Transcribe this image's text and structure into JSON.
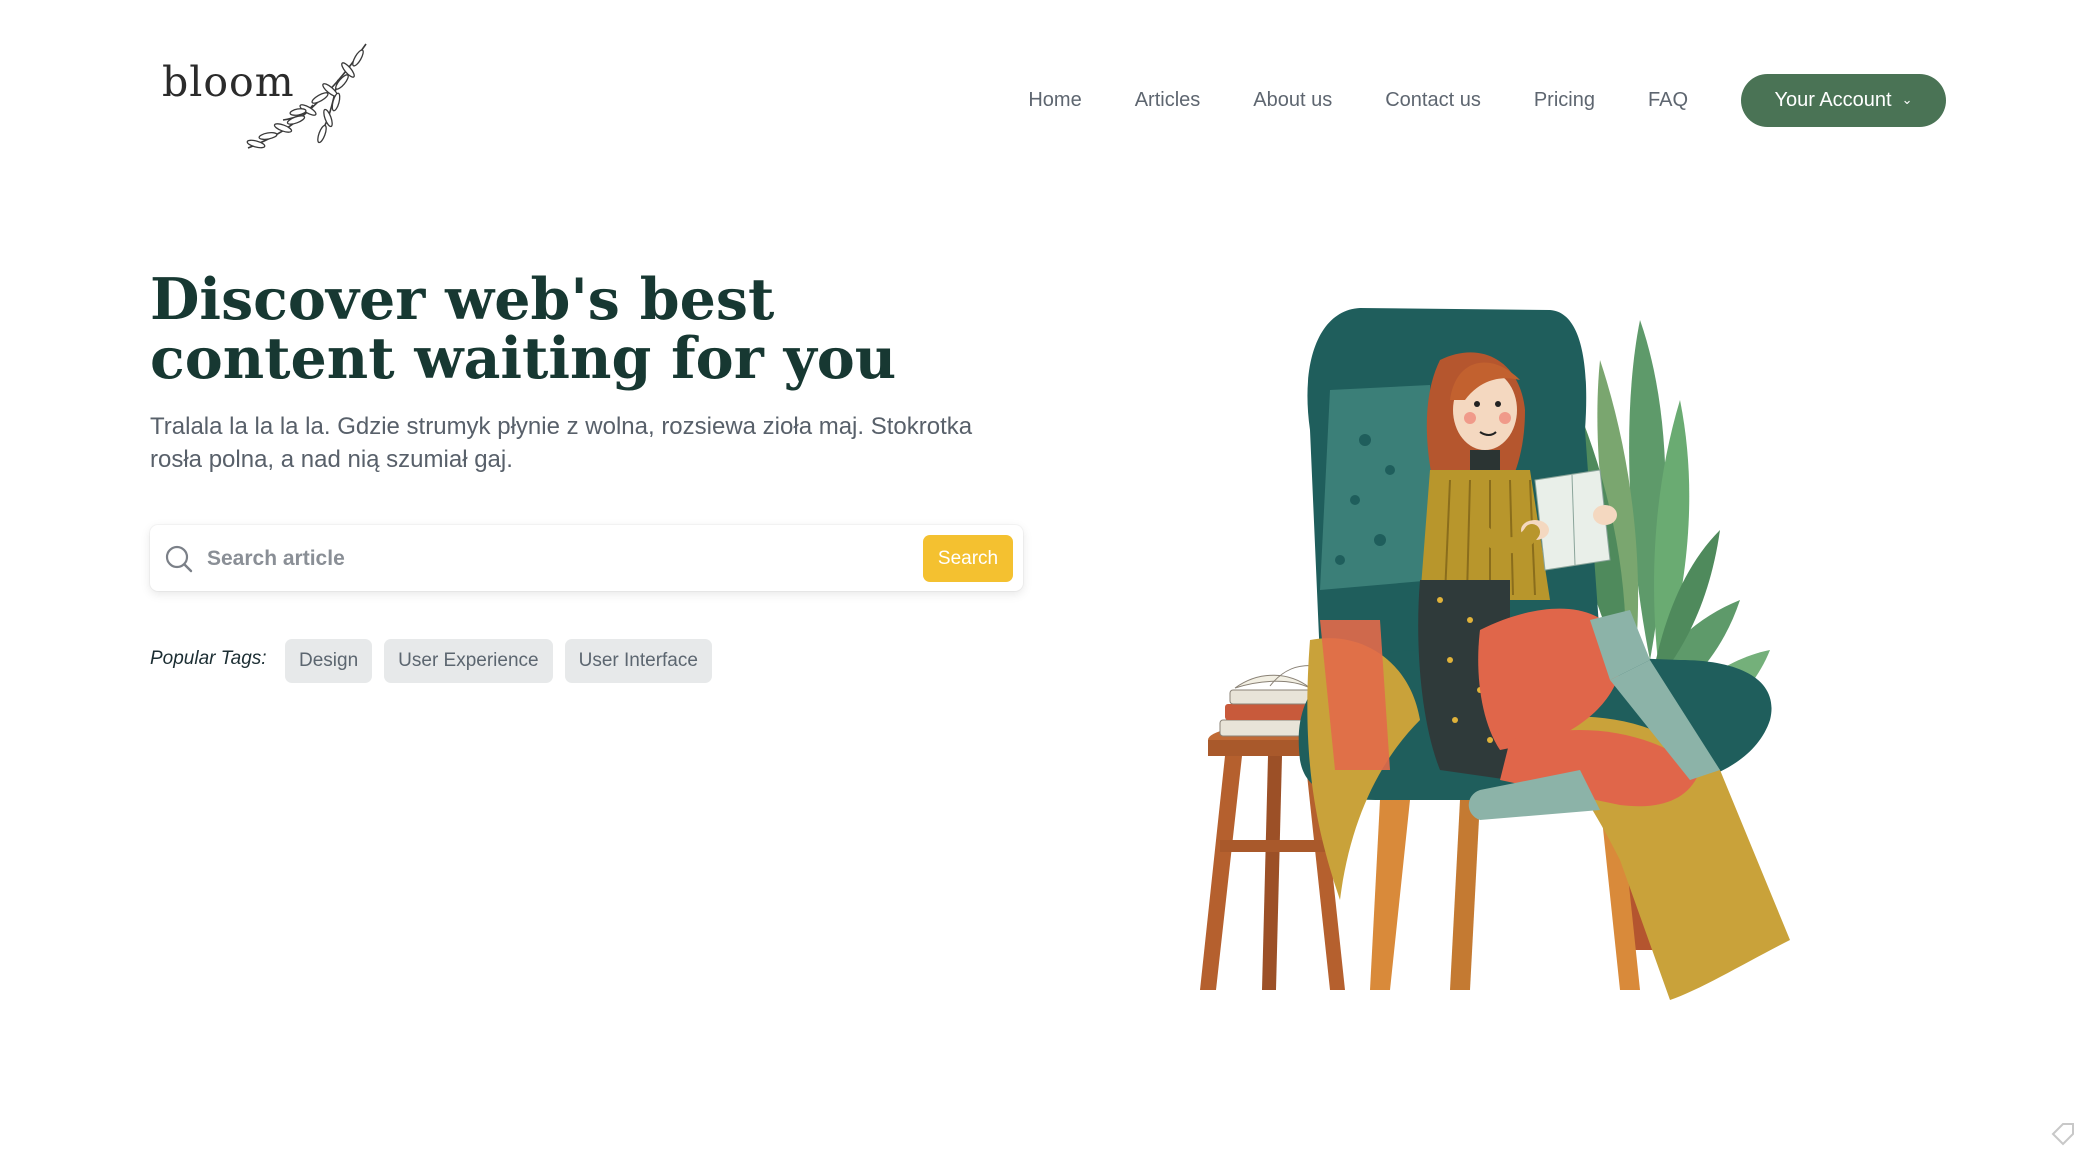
{
  "brand": {
    "name": "bloom",
    "logo_icon": "olive-branch-icon"
  },
  "nav": {
    "links": [
      "Home",
      "Articles",
      "About us",
      "Contact us",
      "Pricing",
      "FAQ"
    ],
    "account_label": "Your Account",
    "account_icon": "chevron-down-icon"
  },
  "hero": {
    "title_line1": "Discover web's best",
    "title_line2": "content waiting for you",
    "subtitle": "Tralala la la la la. Gdzie strumyk płynie z wolna, rozsiewa zioła maj. Stokrotka rosła polna, a nad nią szumiał gaj."
  },
  "search": {
    "placeholder": "Search article",
    "value": "",
    "button_label": "Search",
    "icon": "search-icon"
  },
  "tags": {
    "label": "Popular Tags:",
    "items": [
      "Design",
      "User Experience",
      "User Interface"
    ]
  },
  "illustration": {
    "icon": "woman-reading-in-armchair-illustration"
  },
  "colors": {
    "accent_green": "#4a7355",
    "button_yellow": "#f4c130",
    "title_dark": "#173832",
    "text_gray": "#58606a",
    "tag_bg": "#e7e9ea"
  }
}
